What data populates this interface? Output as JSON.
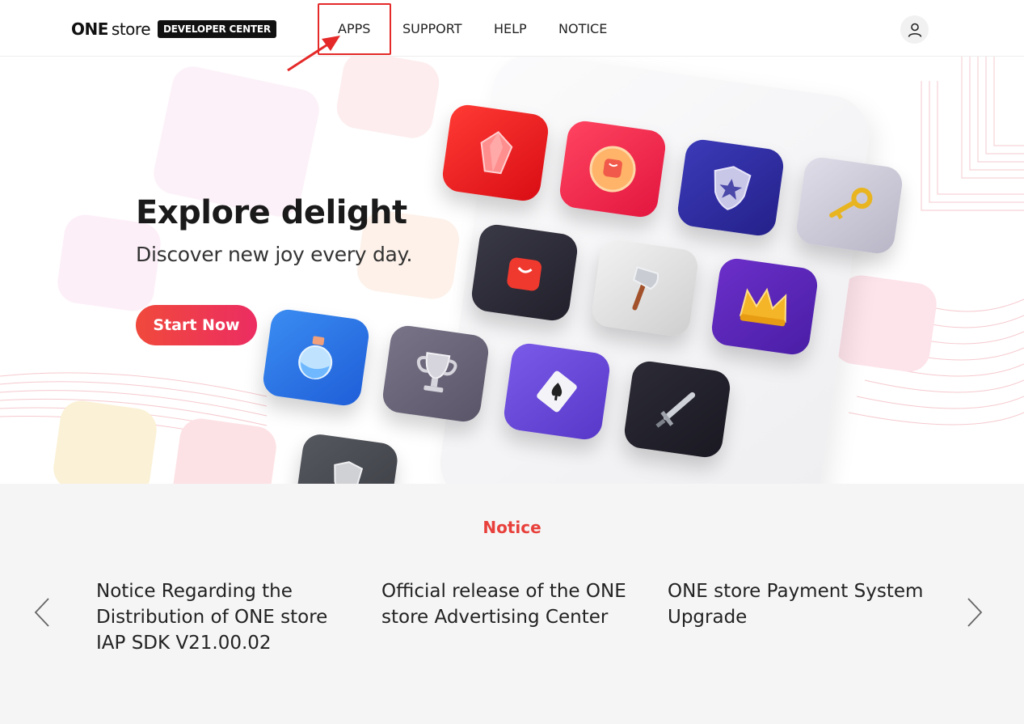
{
  "header": {
    "logo_one": "ONE",
    "logo_store": "store",
    "logo_badge": "DEVELOPER CENTER",
    "nav": {
      "apps": "APPS",
      "support": "SUPPORT",
      "help": "HELP",
      "notice": "NOTICE"
    },
    "icons": {
      "user": "user-icon",
      "arrow": "red-arrow-annotation"
    }
  },
  "hero": {
    "title": "Explore delight",
    "subtitle": "Discover new joy every day.",
    "cta": "Start Now",
    "tile_icons": [
      "gem-icon",
      "coin-icon",
      "shield-star-icon",
      "key-icon",
      "bag-icon",
      "axe-icon",
      "crown-icon",
      "potion-icon",
      "trophy-icon",
      "spade-card-icon",
      "sword-icon",
      "shield-icon"
    ]
  },
  "notice": {
    "title": "Notice",
    "items": [
      "Notice Regarding the Distribution of ONE store IAP SDK V21.00.02",
      "Official release of the ONE store Advertising Center",
      "ONE store Payment System Upgrade"
    ]
  },
  "colors": {
    "accent": "#e8403b",
    "cta_start": "#f0493c",
    "cta_end": "#ec2d62",
    "annotation": "#e52929"
  }
}
